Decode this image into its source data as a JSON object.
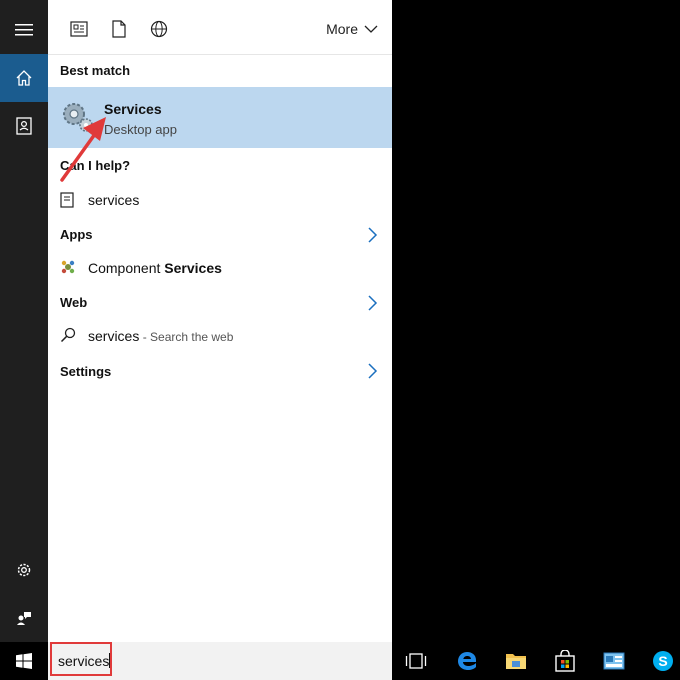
{
  "topbar": {
    "more_label": "More"
  },
  "best_match": {
    "heading": "Best match",
    "title": "Services",
    "subtitle": "Desktop app"
  },
  "help": {
    "heading": "Can I help?",
    "item": "services"
  },
  "apps": {
    "heading": "Apps",
    "item_prefix": "Component ",
    "item_bold": "Services"
  },
  "web": {
    "heading": "Web",
    "query": "services",
    "suffix": " - Search the web"
  },
  "settings": {
    "heading": "Settings"
  },
  "search": {
    "value": "services"
  },
  "colors": {
    "highlight": "#bcd7ef",
    "accent": "#1b5c8f",
    "annotation": "#e03a3a"
  }
}
